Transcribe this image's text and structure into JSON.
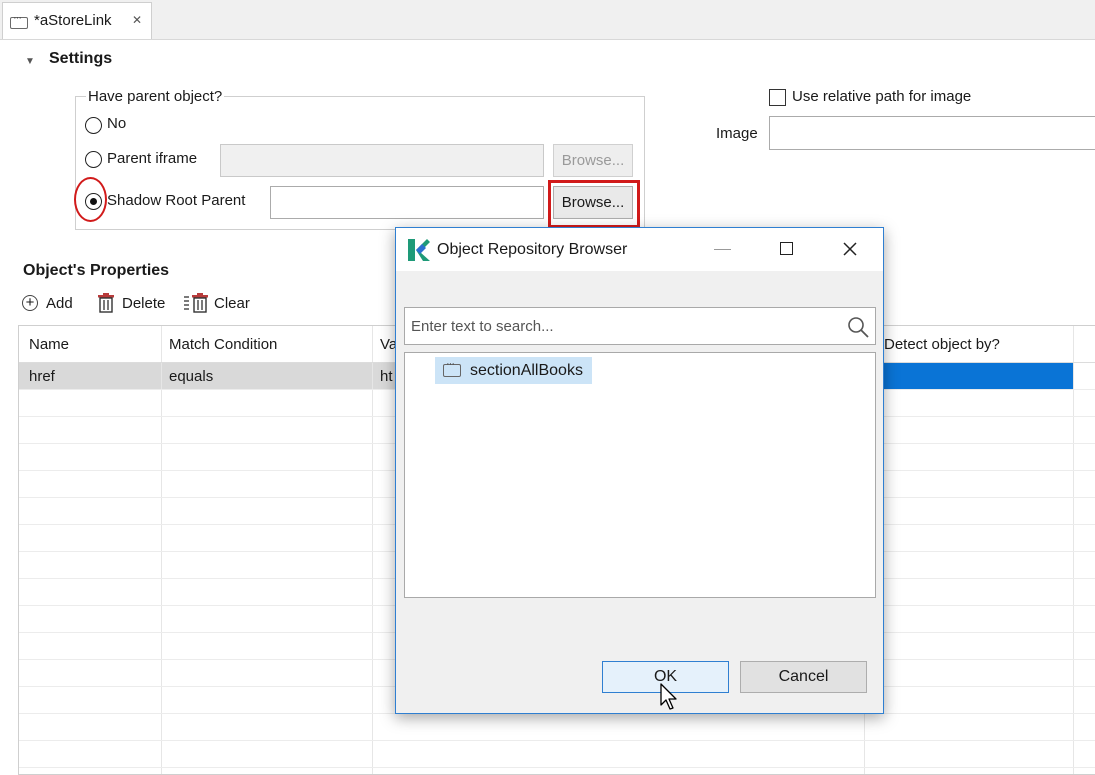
{
  "editor_tab": {
    "title": "*aStoreLink",
    "close_glyph": "✕"
  },
  "settings": {
    "section_title": "Settings",
    "have_parent_label": "Have parent object?",
    "options": [
      {
        "label": "No",
        "selected": false
      },
      {
        "label": "Parent iframe",
        "selected": false
      },
      {
        "label": "Shadow Root Parent",
        "selected": true
      }
    ],
    "browse_label": "Browse...",
    "use_relative_path_label": "Use relative path for image",
    "image_label": "Image"
  },
  "properties": {
    "section_title": "Object's Properties",
    "toolbar": {
      "add": "Add",
      "delete": "Delete",
      "clear": "Clear"
    },
    "columns": [
      "Name",
      "Match Condition",
      "Va",
      "Detect object by?"
    ],
    "rows": [
      {
        "name": "href",
        "match_condition": "equals",
        "value": "ht"
      }
    ]
  },
  "dialog": {
    "title": "Object Repository Browser",
    "search_placeholder": "Enter text to search...",
    "tree_items": [
      "sectionAllBooks"
    ],
    "ok_label": "OK",
    "cancel_label": "Cancel"
  },
  "colors": {
    "selected_row": "#d9d9d9",
    "selected_cell_blue": "#0a74d6",
    "tree_selection": "#cce4f7",
    "annotation_red": "#d11a1a",
    "ok_border": "#2f7fd1"
  }
}
